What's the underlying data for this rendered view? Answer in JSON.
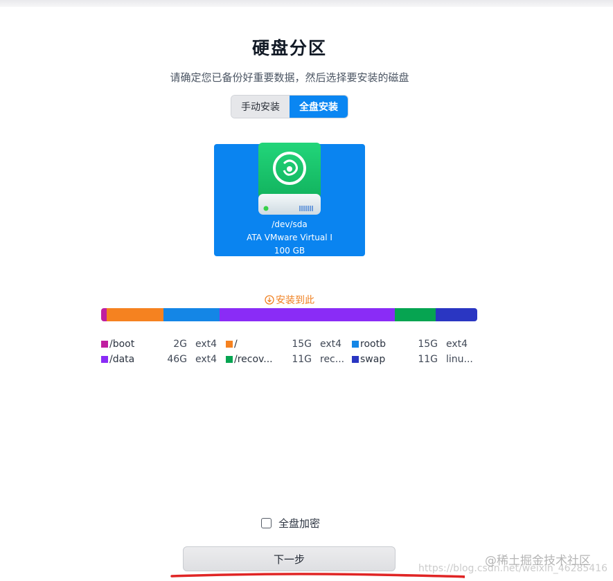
{
  "page": {
    "title": "硬盘分区",
    "subtitle": "请确定您已备份好重要数据，然后选择要安装的磁盘"
  },
  "mode_switch": {
    "manual_label": "手动安装",
    "full_label": "全盘安装",
    "selected": "full"
  },
  "disk": {
    "path": "/dev/sda",
    "model": "ATA VMware Virtual I",
    "size": "100 GB"
  },
  "install_hint": "安装到此",
  "partitions": [
    {
      "name": "/boot",
      "size": "2G",
      "fs": "ext4",
      "color": "#c01fa0",
      "share": 0.015
    },
    {
      "name": "/",
      "size": "15G",
      "fs": "ext4",
      "color": "#f58220",
      "share": 0.15
    },
    {
      "name": "rootb",
      "size": "15G",
      "fs": "ext4",
      "color": "#1486e6",
      "share": 0.15
    },
    {
      "name": "/data",
      "size": "46G",
      "fs": "ext4",
      "color": "#8a2cf6",
      "share": 0.465
    },
    {
      "name": "/recov...",
      "size": "11G",
      "fs": "rec...",
      "color": "#06a451",
      "share": 0.11
    },
    {
      "name": "swap",
      "size": "11G",
      "fs": "linu...",
      "color": "#2a36c2",
      "share": 0.11
    }
  ],
  "encrypt": {
    "label": "全盘加密",
    "checked": false
  },
  "next_button": "下一步",
  "watermarks": {
    "line1": "@稀土掘金技术社区",
    "line2": "https://blog.csdn.net/weixin_46285416"
  },
  "colors": {
    "accent": "#0a86f2",
    "hint": "#f08020",
    "disk_icon": "#18c46a"
  },
  "icons": {
    "disk": "hard-disk-icon",
    "install_hint": "download-circle-icon"
  }
}
